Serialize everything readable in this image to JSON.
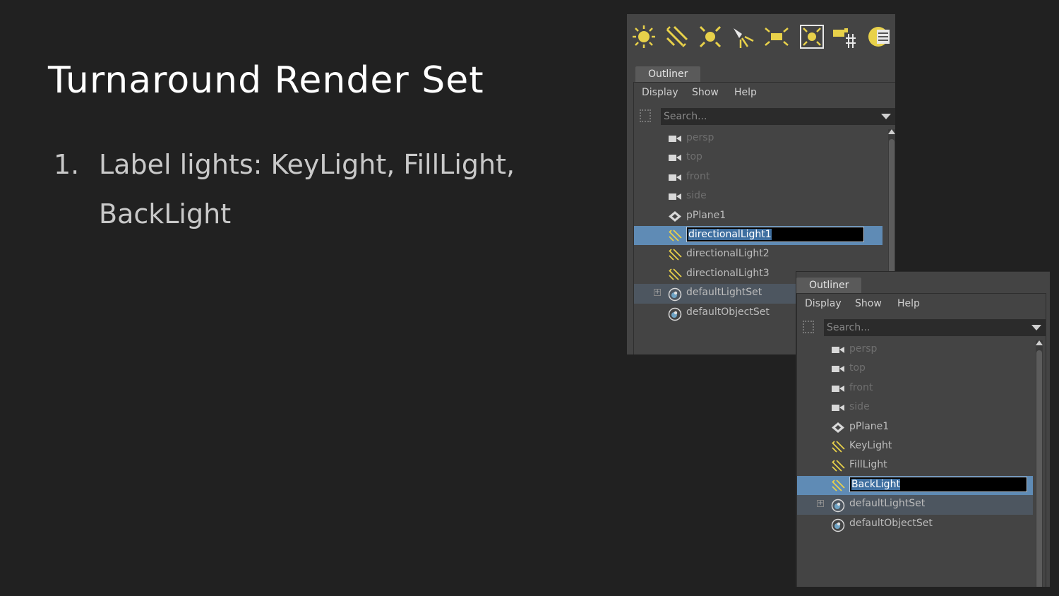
{
  "slide": {
    "title": "Turnaround Render Set",
    "bullet_number": "1.",
    "bullet_text": "Label lights: KeyLight, FillLight, BackLight"
  },
  "toolbar": {
    "icons": [
      "ambient-light-icon",
      "directional-light-icon",
      "point-light-icon",
      "spot-light-icon",
      "area-light-icon",
      "volume-light-icon",
      "light-manipulator-icon",
      "light-editor-icon"
    ],
    "accent": "#e8d14a"
  },
  "outliner_before": {
    "tab": "Outliner",
    "menu": {
      "display": "Display",
      "show": "Show",
      "help": "Help"
    },
    "search_placeholder": "Search...",
    "items": [
      {
        "label": "persp",
        "type": "camera",
        "dim": true
      },
      {
        "label": "top",
        "type": "camera",
        "dim": true
      },
      {
        "label": "front",
        "type": "camera",
        "dim": true
      },
      {
        "label": "side",
        "type": "camera",
        "dim": true
      },
      {
        "label": "pPlane1",
        "type": "mesh"
      },
      {
        "label": "directionalLight1",
        "type": "light",
        "selected": true,
        "editing": true
      },
      {
        "label": "directionalLight2",
        "type": "light"
      },
      {
        "label": "directionalLight3",
        "type": "light"
      },
      {
        "label": "defaultLightSet",
        "type": "set",
        "expandable": true,
        "highlight": true
      },
      {
        "label": "defaultObjectSet",
        "type": "set"
      }
    ]
  },
  "outliner_after": {
    "tab": "Outliner",
    "menu": {
      "display": "Display",
      "show": "Show",
      "help": "Help"
    },
    "search_placeholder": "Search...",
    "items": [
      {
        "label": "persp",
        "type": "camera",
        "dim": true
      },
      {
        "label": "top",
        "type": "camera",
        "dim": true
      },
      {
        "label": "front",
        "type": "camera",
        "dim": true
      },
      {
        "label": "side",
        "type": "camera",
        "dim": true
      },
      {
        "label": "pPlane1",
        "type": "mesh"
      },
      {
        "label": "KeyLight",
        "type": "light"
      },
      {
        "label": "FillLight",
        "type": "light"
      },
      {
        "label": "BackLight",
        "type": "light",
        "selected": true,
        "editing": true
      },
      {
        "label": "defaultLightSet",
        "type": "set",
        "expandable": true,
        "highlight": true
      },
      {
        "label": "defaultObjectSet",
        "type": "set"
      }
    ]
  }
}
